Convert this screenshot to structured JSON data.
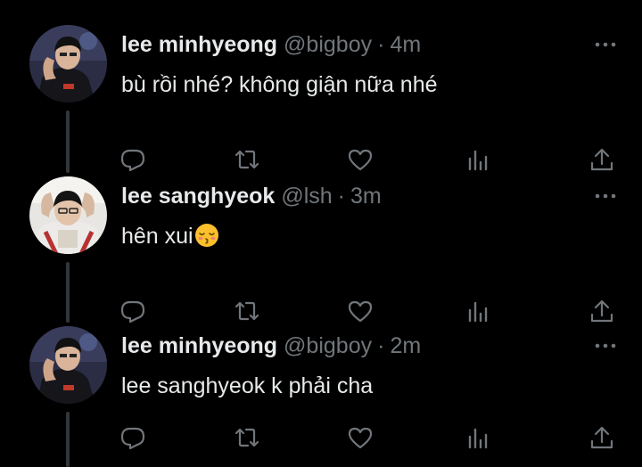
{
  "tweets": [
    {
      "display_name": "lee minhyeong",
      "handle": "@bigboy",
      "separator": "·",
      "time": "4m",
      "text": "bù rồi nhé? không giận nữa nhé",
      "emoji": ""
    },
    {
      "display_name": "lee sanghyeok",
      "handle": "@lsh",
      "separator": "·",
      "time": "3m",
      "text": "hên xui",
      "emoji": "kissing-face-with-closed-eyes"
    },
    {
      "display_name": "lee minhyeong",
      "handle": "@bigboy",
      "separator": "·",
      "time": "2m",
      "text": "lee sanghyeok k phải cha",
      "emoji": ""
    }
  ],
  "icons": {
    "reply": "reply-icon",
    "retweet": "retweet-icon",
    "like": "heart-icon",
    "views": "views-icon",
    "share": "share-icon",
    "more": "more-icon"
  },
  "colors": {
    "background": "#000000",
    "text_primary": "#e7e9ea",
    "text_secondary": "#71767b",
    "thread_line": "#333639"
  }
}
